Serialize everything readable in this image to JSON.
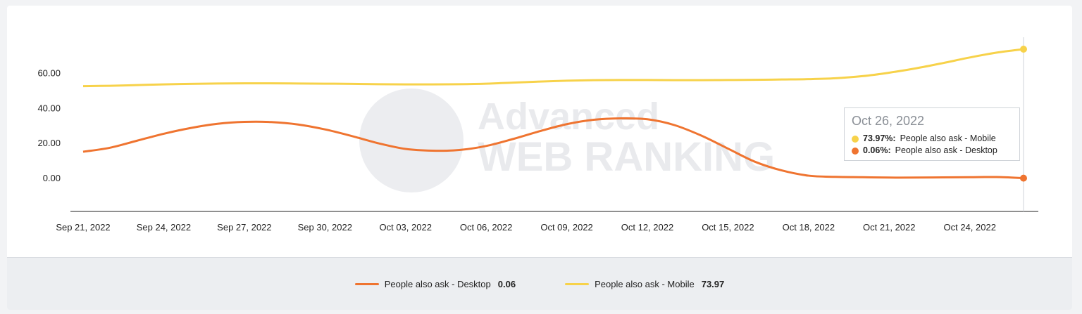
{
  "colors": {
    "desktop": "#ef7430",
    "mobile": "#f7d24a",
    "axis": "#222222",
    "watermark": "#e9eaed"
  },
  "watermark": {
    "line1": "Advanced",
    "line2": "WEB RANKING"
  },
  "chart_data": {
    "type": "line",
    "title": "",
    "xlabel": "",
    "ylabel": "",
    "x": [
      "Sep 21, 2022",
      "Sep 22, 2022",
      "Sep 23, 2022",
      "Sep 24, 2022",
      "Sep 25, 2022",
      "Sep 26, 2022",
      "Sep 27, 2022",
      "Sep 28, 2022",
      "Sep 29, 2022",
      "Sep 30, 2022",
      "Oct 01, 2022",
      "Oct 02, 2022",
      "Oct 03, 2022",
      "Oct 04, 2022",
      "Oct 05, 2022",
      "Oct 06, 2022",
      "Oct 07, 2022",
      "Oct 08, 2022",
      "Oct 09, 2022",
      "Oct 10, 2022",
      "Oct 11, 2022",
      "Oct 12, 2022",
      "Oct 13, 2022",
      "Oct 14, 2022",
      "Oct 15, 2022",
      "Oct 16, 2022",
      "Oct 17, 2022",
      "Oct 18, 2022",
      "Oct 19, 2022",
      "Oct 20, 2022",
      "Oct 21, 2022",
      "Oct 22, 2022",
      "Oct 23, 2022",
      "Oct 24, 2022",
      "Oct 25, 2022",
      "Oct 26, 2022"
    ],
    "x_tick_labels": [
      "Sep 21, 2022",
      "Sep 24, 2022",
      "Sep 27, 2022",
      "Sep 30, 2022",
      "Oct 03, 2022",
      "Oct 06, 2022",
      "Oct 09, 2022",
      "Oct 12, 2022",
      "Oct 15, 2022",
      "Oct 18, 2022",
      "Oct 21, 2022",
      "Oct 24, 2022"
    ],
    "y_tick_labels": [
      "0.00",
      "20.00",
      "40.00",
      "60.00"
    ],
    "ylim": [
      -19,
      80
    ],
    "grid": false,
    "legend_position": "bottom",
    "series": [
      {
        "name": "People also ask - Desktop",
        "color_key": "desktop",
        "values": [
          15.2,
          17.5,
          21.5,
          25.5,
          28.8,
          31.2,
          32.3,
          32.2,
          30.8,
          28,
          24.2,
          20,
          16.8,
          15.8,
          16.2,
          18.5,
          22.5,
          27,
          31,
          33.5,
          34.3,
          33.8,
          30.5,
          24.5,
          17,
          9.5,
          4.5,
          1.5,
          0.8,
          0.6,
          0.4,
          0.4,
          0.5,
          0.6,
          0.7,
          0.06
        ]
      },
      {
        "name": "People also ask - Mobile",
        "color_key": "mobile",
        "values": [
          52.8,
          53.0,
          53.4,
          53.8,
          54.1,
          54.3,
          54.4,
          54.4,
          54.3,
          54.2,
          54.1,
          53.9,
          53.8,
          53.8,
          53.9,
          54.2,
          54.8,
          55.4,
          55.9,
          56.2,
          56.3,
          56.3,
          56.2,
          56.2,
          56.3,
          56.4,
          56.6,
          56.8,
          57.3,
          58.5,
          60.5,
          63.0,
          66.0,
          69.2,
          72.0,
          73.97
        ]
      }
    ]
  },
  "tooltip": {
    "date": "Oct 26, 2022",
    "rows": [
      {
        "value": "73.97%:",
        "label": "People also ask - Mobile",
        "color_key": "mobile"
      },
      {
        "value": "0.06%:",
        "label": "People also ask - Desktop",
        "color_key": "desktop"
      }
    ]
  },
  "legend": {
    "items": [
      {
        "label": "People also ask - Desktop",
        "value": "0.06",
        "color_key": "desktop"
      },
      {
        "label": "People also ask - Mobile",
        "value": "73.97",
        "color_key": "mobile"
      }
    ]
  }
}
